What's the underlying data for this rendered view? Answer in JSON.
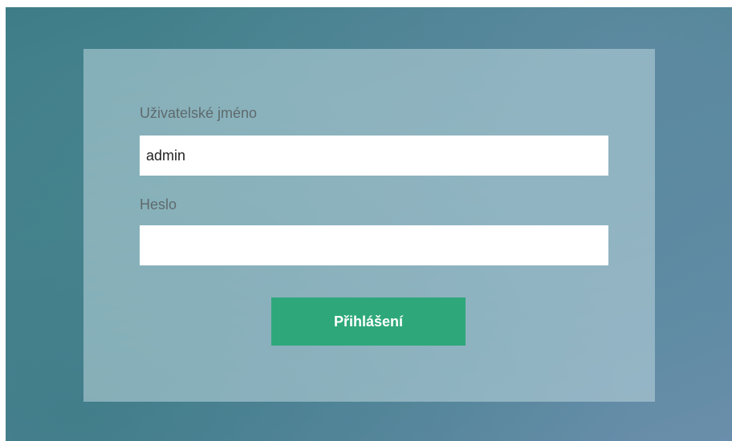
{
  "login_form": {
    "username_label": "Uživatelské jméno",
    "username_value": "admin",
    "password_label": "Heslo",
    "password_value": "",
    "submit_label": "Přihlášení"
  },
  "colors": {
    "background": "#4c8793",
    "panel": "#a9c7cf",
    "button": "#2ea87a",
    "label_text": "#5f6a6d"
  }
}
